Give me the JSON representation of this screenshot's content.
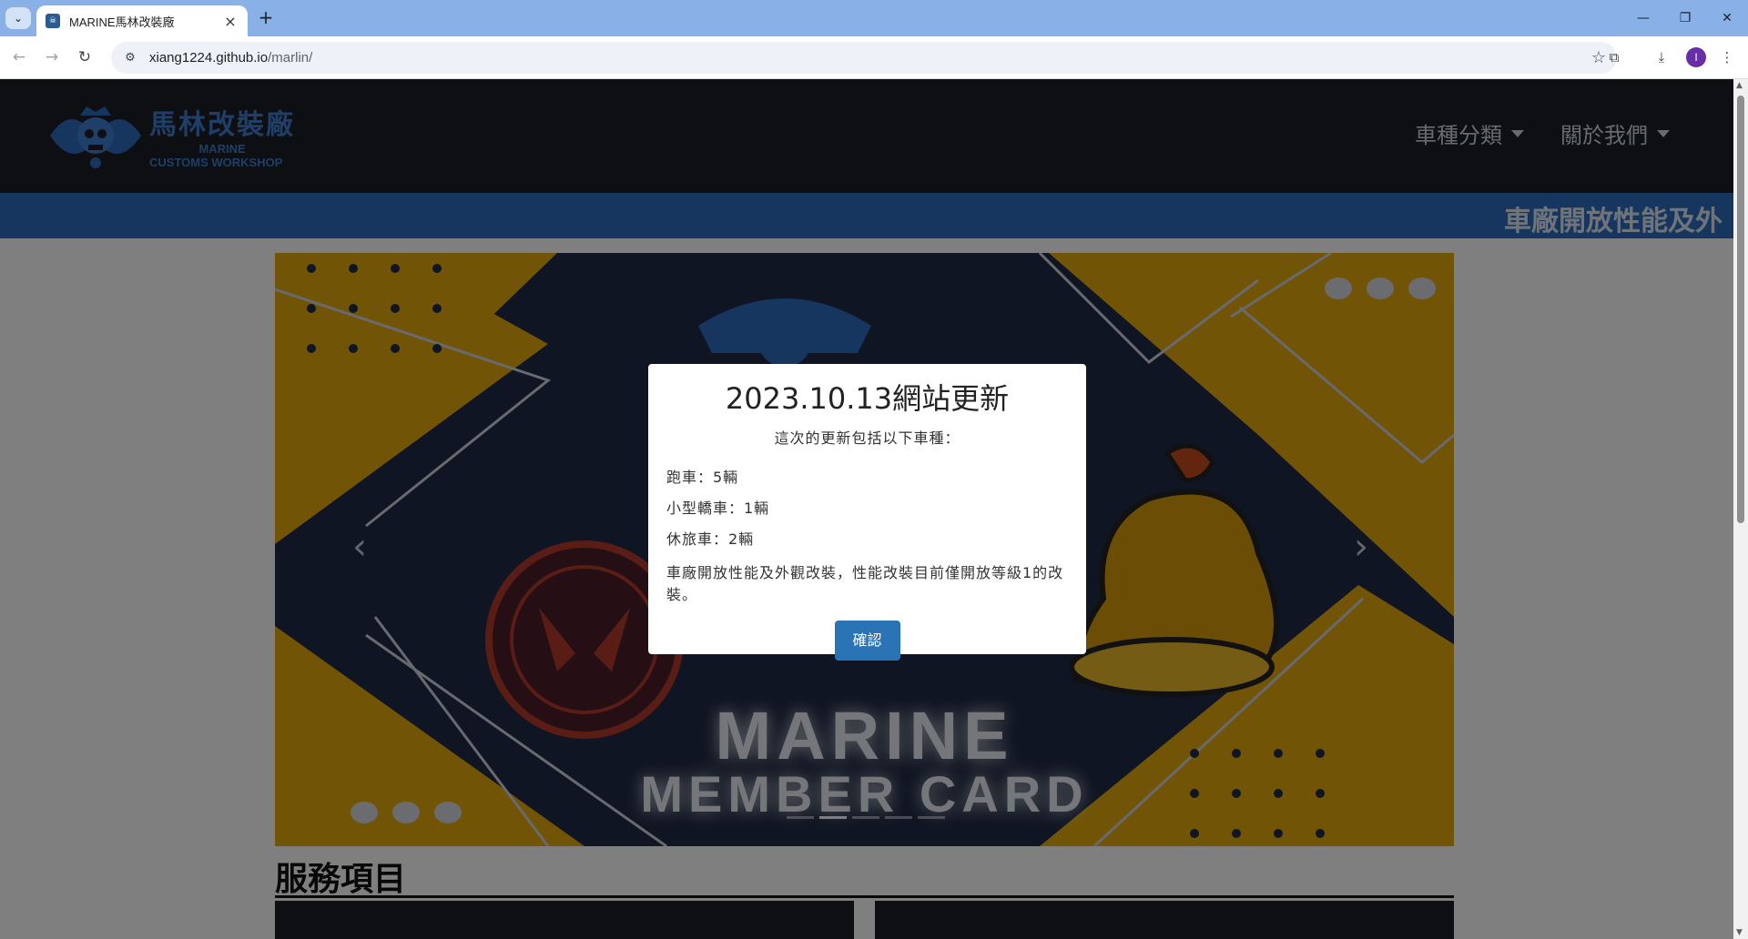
{
  "browser": {
    "tab_title": "MARINE馬林改裝廠",
    "url_host": "xiang1224.github.io",
    "url_path": "/marlin/",
    "avatar_initial": "I"
  },
  "site": {
    "logo_cn": "馬林改裝廠",
    "logo_en_1": "MARINE",
    "logo_en_2": "CUSTOMS WORKSHOP",
    "nav": [
      {
        "label": "車種分類"
      },
      {
        "label": "關於我們"
      }
    ],
    "marquee": "車廠開放性能及外",
    "carousel": {
      "title_1": "MARINE",
      "title_2": "MEMBER CARD",
      "slide_count": 5,
      "active_slide": 2
    },
    "section_title": "服務項目"
  },
  "modal": {
    "title": "2023.10.13網站更新",
    "subtitle": "這次的更新包括以下車種：",
    "items": [
      {
        "text": "跑車：5輛"
      },
      {
        "text": "小型轎車：1輛"
      },
      {
        "text": "休旅車：2輛"
      }
    ],
    "note": "車廠開放性能及外觀改裝，性能改裝目前僅開放等級1的改裝。",
    "confirm_label": "確認"
  },
  "colors": {
    "header_bg": "#1a1e25",
    "brand_blue": "#2f6cbf",
    "button_blue": "#2a73b5",
    "card_yellow": "#e3a90d",
    "card_navy": "#1f2a44"
  }
}
